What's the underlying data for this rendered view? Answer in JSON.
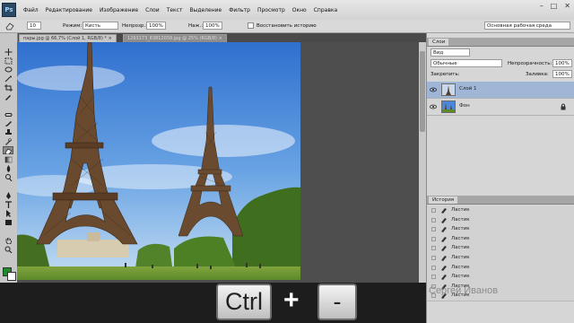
{
  "app": {
    "logo": "Ps",
    "accent": "#2c4a66"
  },
  "menubar": {
    "items": [
      "Файл",
      "Редактирование",
      "Изображение",
      "Слои",
      "Текст",
      "Выделение",
      "Фильтр",
      "Просмотр",
      "Окно",
      "Справка"
    ],
    "window_controls": [
      "–",
      "□",
      "✕"
    ]
  },
  "options": {
    "brush_size": "10",
    "mode_label": "Режим:",
    "mode_value": "Кисть",
    "opacity_label": "Непрозр.:",
    "opacity_value": "100%",
    "flow_label": "Наж.:",
    "flow_value": "100%",
    "history_label": "Восстановить историю",
    "workspace": "Основная рабочая среда"
  },
  "tabs": [
    {
      "label": "пары.jpg @ 66,7% (Слой 1, RGB/8) *",
      "close": "×"
    },
    {
      "label": "1263173_83812058.jpg @ 25% (RGB/8)",
      "close": "×"
    }
  ],
  "layers_panel": {
    "tab": "Слои",
    "kind": "Вид",
    "blend": "Обычные",
    "opacity_label": "Непрозрачность:",
    "opacity_value": "100%",
    "lock_label": "Закрепить:",
    "fill_label": "Заливка:",
    "fill_value": "100%",
    "layers": [
      {
        "name": "Слой 1",
        "selected": true
      },
      {
        "name": "Фон",
        "selected": false
      }
    ]
  },
  "history_panel": {
    "tab": "История",
    "items": [
      "Ластик",
      "Ластик",
      "Ластик",
      "Ластик",
      "Ластик",
      "Ластик",
      "Ластик",
      "Ластик",
      "Ластик",
      "Ластик"
    ]
  },
  "overlay": {
    "key1": "Ctrl",
    "plus": "+",
    "key2": "-",
    "watermark": "Сергей Иванов"
  }
}
